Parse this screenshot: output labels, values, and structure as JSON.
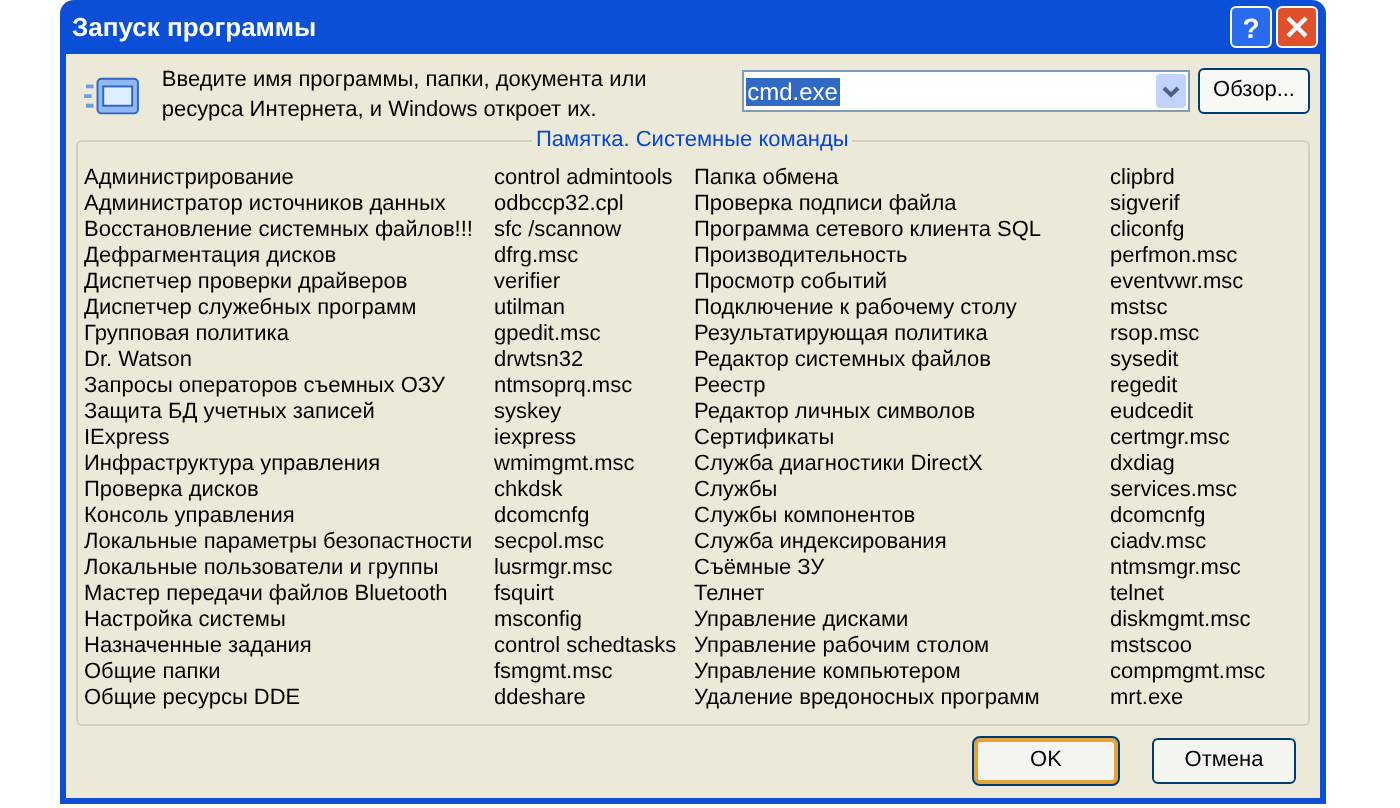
{
  "window": {
    "title": "Запуск программы",
    "help_button": "?"
  },
  "prompt": "Введите имя программы, папки, документа или ресурса Интернета, и Windows откроет их.",
  "open_field": {
    "value": "cmd.exe",
    "text_selected": true
  },
  "browse_button": "Обзор...",
  "group_title": "Памятка. Системные команды",
  "columns": [
    {
      "items": [
        {
          "name": "Администрирование",
          "command": "control admintools"
        },
        {
          "name": "Администратор источников данных",
          "command": "odbccp32.cpl"
        },
        {
          "name": "Восстановление системных файлов!!!",
          "command": "sfc /scannow"
        },
        {
          "name": "Дефрагментация дисков",
          "command": "dfrg.msc"
        },
        {
          "name": "Диспетчер проверки драйверов",
          "command": "verifier"
        },
        {
          "name": "Диспетчер служебных программ",
          "command": "utilman"
        },
        {
          "name": "Групповая политика",
          "command": "gpedit.msc"
        },
        {
          "name": "Dr. Watson",
          "command": "drwtsn32"
        },
        {
          "name": "Запросы операторов съемных ОЗУ",
          "command": "ntmsoprq.msc"
        },
        {
          "name": "Защита БД учетных записей",
          "command": "syskey"
        },
        {
          "name": "IExpress",
          "command": "iexpress"
        },
        {
          "name": "Инфраструктура управления",
          "command": "wmimgmt.msc"
        },
        {
          "name": "Проверка дисков",
          "command": "chkdsk"
        },
        {
          "name": "Консоль управления",
          "command": "dcomcnfg"
        },
        {
          "name": "Локальные параметры безопастности",
          "command": "secpol.msc"
        },
        {
          "name": "Локальные пользователи и группы",
          "command": "lusrmgr.msc"
        },
        {
          "name": "Мастер передачи файлов Bluetooth",
          "command": "fsquirt"
        },
        {
          "name": "Настройка системы",
          "command": "msconfig"
        },
        {
          "name": "Назначенные задания",
          "command": "control schedtasks"
        },
        {
          "name": "Общие папки",
          "command": "fsmgmt.msc"
        },
        {
          "name": "Общие ресурсы DDE",
          "command": "ddeshare"
        }
      ]
    },
    {
      "items": [
        {
          "name": "Папка обмена",
          "command": "clipbrd"
        },
        {
          "name": "Проверка подписи файла",
          "command": "sigverif"
        },
        {
          "name": "Программа сетевого клиента SQL",
          "command": "cliconfg"
        },
        {
          "name": "Производительность",
          "command": "perfmon.msc"
        },
        {
          "name": "Просмотр событий",
          "command": "eventvwr.msc"
        },
        {
          "name": "Подключение к рабочему столу",
          "command": "mstsc"
        },
        {
          "name": "Результатирующая политика",
          "command": "rsop.msc"
        },
        {
          "name": "Редактор системных файлов",
          "command": "sysedit"
        },
        {
          "name": "Реестр",
          "command": "regedit"
        },
        {
          "name": "Редактор личных символов",
          "command": "eudcedit"
        },
        {
          "name": "Сертификаты",
          "command": "certmgr.msc"
        },
        {
          "name": "Служба диагностики DirectX",
          "command": "dxdiag"
        },
        {
          "name": "Службы",
          "command": "services.msc"
        },
        {
          "name": "Службы компонентов",
          "command": "dcomcnfg"
        },
        {
          "name": "Служба индексирования",
          "command": "ciadv.msc"
        },
        {
          "name": "Съёмные ЗУ",
          "command": "ntmsmgr.msc"
        },
        {
          "name": "Телнет",
          "command": "telnet"
        },
        {
          "name": "Управление дисками",
          "command": "diskmgmt.msc"
        },
        {
          "name": "Управление рабочим столом",
          "command": "mstscoo"
        },
        {
          "name": "Управление компьютером",
          "command": "compmgmt.msc"
        },
        {
          "name": "Удаление вредоносных программ",
          "command": "mrt.exe"
        }
      ]
    }
  ],
  "buttons": [
    {
      "label": "OK",
      "default": true
    },
    {
      "label": "Отмена",
      "default": false
    }
  ]
}
